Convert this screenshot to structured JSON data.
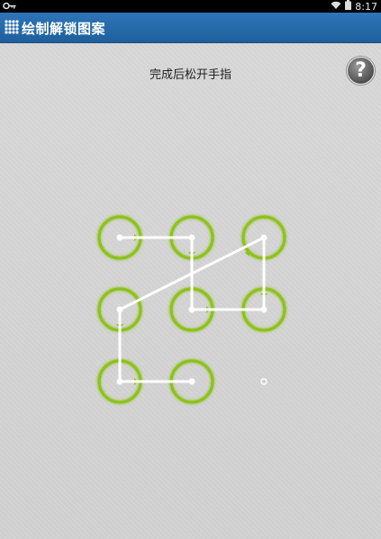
{
  "status_bar": {
    "time": "8:17",
    "icons": [
      "key-icon",
      "wifi-icon",
      "battery-icon"
    ]
  },
  "action_bar": {
    "title": "绘制解锁图案",
    "icon": "grid-dots-icon",
    "color": "#2a6fb0"
  },
  "instruction": "完成后松开手指",
  "help_button": {
    "label": "?"
  },
  "pattern": {
    "grid_size": 3,
    "accent_color": "#8dc21f",
    "line_color": "#ffffff",
    "selected_order": [
      1,
      2,
      5,
      6,
      3,
      4,
      7,
      8
    ]
  }
}
